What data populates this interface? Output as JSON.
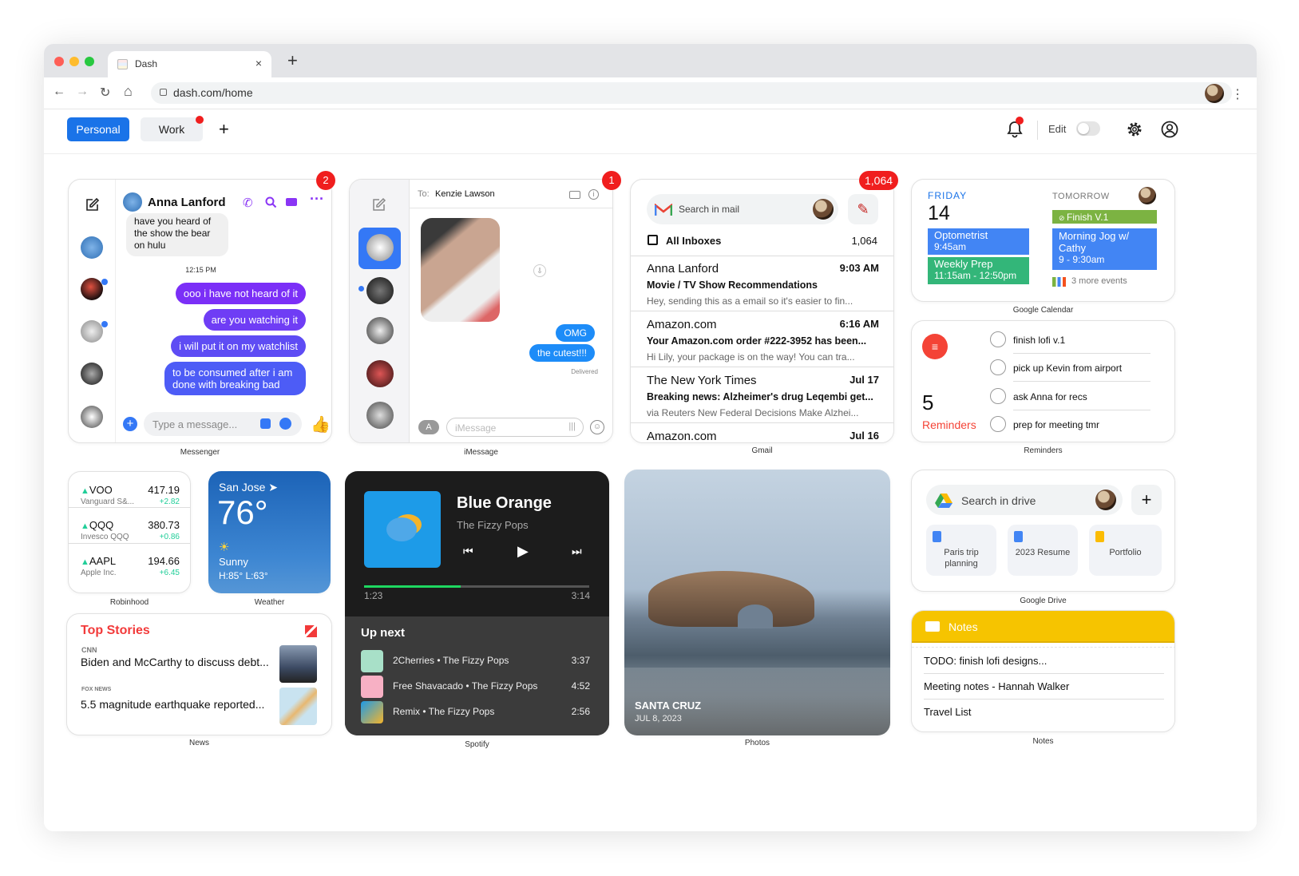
{
  "browser": {
    "tab_title": "Dash",
    "close": "×",
    "new_tab": "+",
    "url": "dash.com/home",
    "star": "☆",
    "menu": "⋮",
    "back": "←",
    "forward": "→",
    "reload": "↻",
    "home": "⌂"
  },
  "header": {
    "tabs": [
      {
        "label": "Personal"
      },
      {
        "label": "Work"
      }
    ],
    "add": "+",
    "edit_label": "Edit"
  },
  "colors": {
    "accent": "#1a73e8",
    "badge": "#f01e1e",
    "messenger_bubble": "#7b2ff7",
    "reminders": "#f44336",
    "notes_header": "#f6c400"
  },
  "messenger": {
    "badge": "2",
    "contact": "Anna Lanford",
    "incoming": "have you heard of the show the bear on hulu",
    "time": "12:15 PM",
    "messages": [
      "ooo i have not heard of it",
      "are you watching it",
      "i will put it on my watchlist",
      "to be consumed after i am done with breaking bad"
    ],
    "input_placeholder": "Type a message...",
    "label": "Messenger"
  },
  "imessage": {
    "badge": "1",
    "to_label": "To:",
    "to": "Kenzie Lawson",
    "messages": [
      "OMG",
      "the cutest!!!"
    ],
    "status": "Delivered",
    "input_placeholder": "iMessage",
    "label": "iMessage"
  },
  "gmail": {
    "badge": "1,064",
    "search": "Search in mail",
    "inbox": "All Inboxes",
    "inbox_count": "1,064",
    "emails": [
      {
        "from": "Anna Lanford",
        "time": "9:03 AM",
        "subject": "Movie / TV Show Recommendations",
        "preview": "Hey, sending this as a email so it's easier to fin..."
      },
      {
        "from": "Amazon.com",
        "time": "6:16 AM",
        "subject": "Your Amazon.com order #222-3952 has been...",
        "preview": "Hi Lily, your package is on the way! You can tra..."
      },
      {
        "from": "The New York Times",
        "time": "Jul 17",
        "subject": "Breaking news: Alzheimer's drug Leqembi get...",
        "preview": "via Reuters New Federal Decisions Make Alzhei..."
      },
      {
        "from": "Amazon.com",
        "time": "Jul 16"
      }
    ],
    "label": "Gmail"
  },
  "calendar": {
    "today_name": "FRIDAY",
    "today_num": "14",
    "tomorrow": "TOMORROW",
    "today_events": [
      {
        "title": "Optometrist",
        "time": "9:45am"
      },
      {
        "title": "Weekly Prep",
        "time": "11:15am - 12:50pm"
      }
    ],
    "tomorrow_events": [
      {
        "title": "Finish V.1"
      },
      {
        "title": "Morning Jog w/ Cathy",
        "time": "9 - 9:30am"
      }
    ],
    "more": "3 more events",
    "label": "Google Calendar"
  },
  "reminders": {
    "count": "5",
    "title": "Reminders",
    "items": [
      "finish lofi v.1",
      "pick up Kevin from airport",
      "ask Anna for recs",
      "prep for meeting tmr"
    ],
    "label": "Reminders"
  },
  "robinhood": {
    "stocks": [
      {
        "ticker": "VOO",
        "name": "Vanguard S&...",
        "price": "417.19",
        "change": "+2.82"
      },
      {
        "ticker": "QQQ",
        "name": "Invesco QQQ",
        "price": "380.73",
        "change": "+0.86"
      },
      {
        "ticker": "AAPL",
        "name": "Apple Inc.",
        "price": "194.66",
        "change": "+6.45"
      }
    ],
    "up": "▲",
    "label": "Robinhood"
  },
  "weather": {
    "city": "San Jose",
    "temp": "76°",
    "condition": "Sunny",
    "hilo": "H:85° L:63°",
    "label": "Weather"
  },
  "spotify": {
    "title": "Blue Orange",
    "artist": "The Fizzy Pops",
    "elapsed": "1:23",
    "duration": "3:14",
    "progress": 0.43,
    "up_next": "Up next",
    "queue": [
      {
        "title": "2Cherries • The Fizzy Pops",
        "time": "3:37"
      },
      {
        "title": "Free Shavacado • The Fizzy Pops",
        "time": "4:52"
      },
      {
        "title": "Remix • The Fizzy Pops",
        "time": "2:56"
      }
    ],
    "label": "Spotify"
  },
  "photos": {
    "place": "SANTA CRUZ",
    "date": "JUL 8, 2023",
    "label": "Photos"
  },
  "drive": {
    "search": "Search in drive",
    "add": "+",
    "docs": [
      "Paris trip planning",
      "2023 Resume",
      "Portfolio"
    ],
    "label": "Google Drive"
  },
  "news": {
    "title": "Top Stories",
    "stories": [
      {
        "source": "CNN",
        "headline": "Biden and McCarthy to discuss debt..."
      },
      {
        "source": "FOX NEWS",
        "headline": "5.5 magnitude earthquake reported..."
      }
    ],
    "label": "News"
  },
  "notes": {
    "title": "Notes",
    "items": [
      "TODO: finish lofi designs...",
      "Meeting notes - Hannah Walker",
      "Travel List"
    ],
    "label": "Notes"
  }
}
